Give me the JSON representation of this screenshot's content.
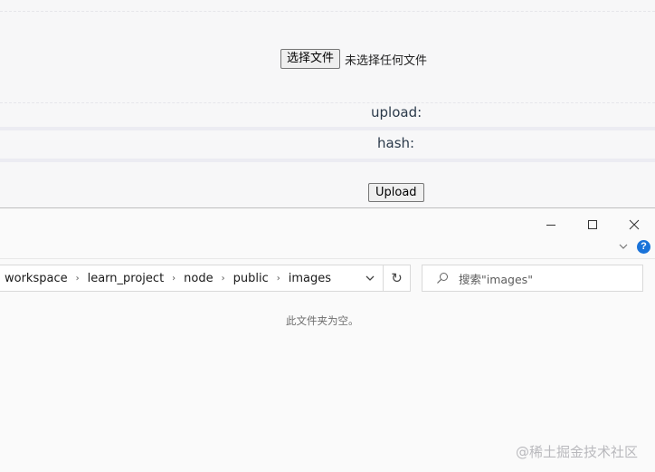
{
  "web_page": {
    "file_input": {
      "button_label": "选择文件",
      "status_text": "未选择任何文件"
    },
    "fields": {
      "upload_label": "upload:",
      "hash_label": "hash:"
    },
    "upload_button_label": "Upload"
  },
  "explorer": {
    "window_controls": {
      "minimize_icon": "minimize-icon",
      "maximize_icon": "maximize-icon",
      "close_icon": "close-icon"
    },
    "ribbon": {
      "expand_icon": "chevron-down-icon",
      "help_glyph": "?",
      "help_color": "#1a73d9"
    },
    "address_bar": {
      "breadcrumbs": [
        "workspace",
        "learn_project",
        "node",
        "public",
        "images"
      ],
      "separator_glyph": "›",
      "refresh_glyph": "↻"
    },
    "search": {
      "placeholder": "搜索\"images\""
    },
    "empty_message": "此文件夹为空。"
  },
  "watermark": "@稀土掘金技术社区"
}
